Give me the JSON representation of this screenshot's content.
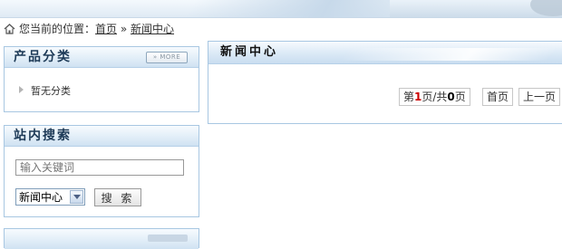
{
  "breadcrumb": {
    "prefix": "您当前的位置：",
    "home_link": "首页",
    "separator": " » ",
    "current_link": "新闻中心"
  },
  "category_panel": {
    "title": "产品分类",
    "more_label": "» MORE",
    "items": [
      {
        "label": "暂无分类"
      }
    ]
  },
  "search_panel": {
    "title": "站内搜索",
    "keyword_placeholder": "输入关键词",
    "select_value": "新闻中心",
    "search_button": "搜 索"
  },
  "news_panel": {
    "title": "新闻中心",
    "pager": {
      "page_prefix": "第",
      "current_page": "1",
      "page_mid": "页/共",
      "total_pages": "0",
      "page_suffix": "页",
      "first_label": "首页",
      "prev_label": "上一页"
    }
  },
  "colors": {
    "panel_border": "#a8c7e2",
    "panel_head": "#cfe2f2",
    "highlight_red": "#cc0000"
  }
}
